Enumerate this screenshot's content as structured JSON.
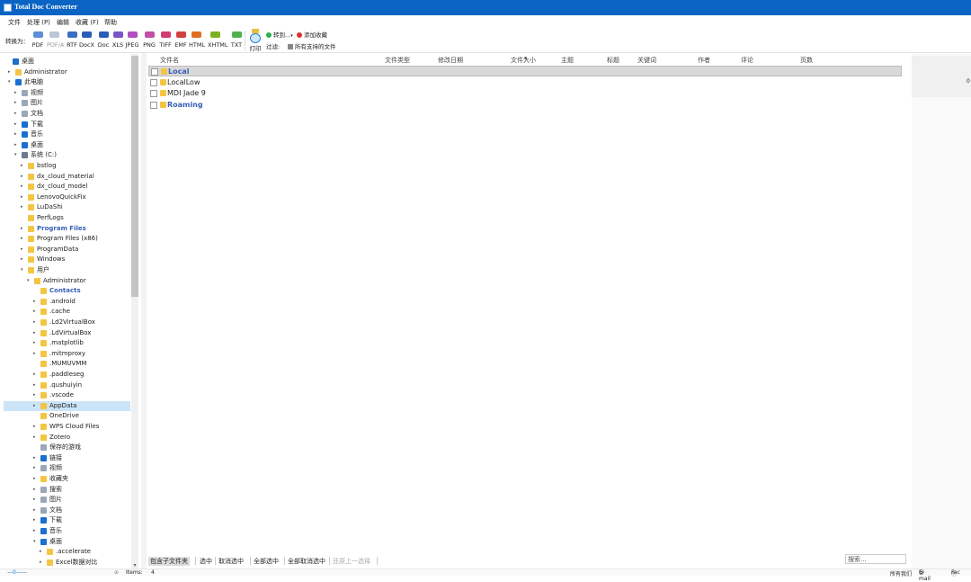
{
  "window": {
    "title": "Total Doc Converter"
  },
  "menu": [
    "文件",
    "处理 (P)",
    "编辑",
    "收藏 (F)",
    "帮助"
  ],
  "toolbar": {
    "convert_label": "转换为：",
    "formats": [
      {
        "label": "PDF",
        "color": "#5b8fd6"
      },
      {
        "label": "PDF/A",
        "color": "#b9c7d8",
        "disabled": true
      },
      {
        "label": "RTF",
        "color": "#3a6fc4"
      },
      {
        "label": "DocX",
        "color": "#2a5cb8"
      },
      {
        "label": "Doc",
        "color": "#2a5cb8"
      },
      {
        "label": "XLS",
        "color": "#7a55c8"
      },
      {
        "label": "JPEG",
        "color": "#b050c0"
      },
      {
        "label": "PNG",
        "color": "#c24fa8"
      },
      {
        "label": "TIFF",
        "color": "#d03a70"
      },
      {
        "label": "EMF",
        "color": "#d04040"
      },
      {
        "label": "HTML",
        "color": "#e07020"
      },
      {
        "label": "XHTML",
        "color": "#80b020"
      },
      {
        "label": "TXT",
        "color": "#50b050"
      }
    ],
    "print_label": "打印",
    "goto_label": "转到...",
    "add_fav_label": "添加收藏",
    "filter_label": "过滤:",
    "filter_value": "所有支持的文件"
  },
  "tree": [
    {
      "label": "桌面",
      "level": 0,
      "icon": "blue"
    },
    {
      "label": "Administrator",
      "level": 1,
      "icon": "user",
      "arrow": "▸"
    },
    {
      "label": "此电脑",
      "level": 1,
      "icon": "pc",
      "arrow": "▾"
    },
    {
      "label": "视频",
      "level": 2,
      "icon": "gray",
      "arrow": "▸"
    },
    {
      "label": "图片",
      "level": 2,
      "icon": "gray",
      "arrow": "▸"
    },
    {
      "label": "文档",
      "level": 2,
      "icon": "gray",
      "arrow": "▸"
    },
    {
      "label": "下载",
      "level": 2,
      "icon": "blue",
      "arrow": "▸"
    },
    {
      "label": "音乐",
      "level": 2,
      "icon": "blue",
      "arrow": "▸"
    },
    {
      "label": "桌面",
      "level": 2,
      "icon": "blue",
      "arrow": "▸"
    },
    {
      "label": "系统 (C:)",
      "level": 2,
      "icon": "drive",
      "arrow": "▾"
    },
    {
      "label": "bstlog",
      "level": 3,
      "icon": "folder",
      "arrow": "▸"
    },
    {
      "label": "dx_cloud_material",
      "level": 3,
      "icon": "folder",
      "arrow": "▸"
    },
    {
      "label": "dx_cloud_model",
      "level": 3,
      "icon": "folder",
      "arrow": "▸"
    },
    {
      "label": "LenovoQuickFix",
      "level": 3,
      "icon": "folder",
      "arrow": "▸"
    },
    {
      "label": "LuDaShi",
      "level": 3,
      "icon": "folder",
      "arrow": "▸"
    },
    {
      "label": "PerfLogs",
      "level": 3,
      "icon": "folder",
      "arrow": ""
    },
    {
      "label": "Program Files",
      "level": 3,
      "icon": "folder",
      "arrow": "▸",
      "bold": true
    },
    {
      "label": "Program Files (x86)",
      "level": 3,
      "icon": "folder",
      "arrow": "▸"
    },
    {
      "label": "ProgramData",
      "level": 3,
      "icon": "folder",
      "arrow": "▸"
    },
    {
      "label": "Windows",
      "level": 3,
      "icon": "folder",
      "arrow": "▸"
    },
    {
      "label": "用户",
      "level": 3,
      "icon": "folder",
      "arrow": "▾"
    },
    {
      "label": "Administrator",
      "level": 4,
      "icon": "folder",
      "arrow": "▾"
    },
    {
      "label": "Contacts",
      "level": 5,
      "icon": "folder",
      "arrow": "",
      "bold": true
    },
    {
      "label": ".android",
      "level": 5,
      "icon": "folder",
      "arrow": "▸"
    },
    {
      "label": ".cache",
      "level": 5,
      "icon": "folder",
      "arrow": "▸"
    },
    {
      "label": ".Ld2VirtualBox",
      "level": 5,
      "icon": "folder",
      "arrow": "▸"
    },
    {
      "label": ".LdVirtualBox",
      "level": 5,
      "icon": "folder",
      "arrow": "▸"
    },
    {
      "label": ".matplotlib",
      "level": 5,
      "icon": "folder",
      "arrow": "▸"
    },
    {
      "label": ".mitmproxy",
      "level": 5,
      "icon": "folder",
      "arrow": "▸"
    },
    {
      "label": ".MUMUVMM",
      "level": 5,
      "icon": "folder",
      "arrow": ""
    },
    {
      "label": ".paddleseg",
      "level": 5,
      "icon": "folder",
      "arrow": "▸"
    },
    {
      "label": ".qushuiyin",
      "level": 5,
      "icon": "folder",
      "arrow": "▸"
    },
    {
      "label": ".vscode",
      "level": 5,
      "icon": "folder",
      "arrow": "▸"
    },
    {
      "label": "AppData",
      "level": 5,
      "icon": "folder",
      "arrow": "▸",
      "selected": true
    },
    {
      "label": "OneDrive",
      "level": 5,
      "icon": "folder",
      "arrow": ""
    },
    {
      "label": "WPS Cloud Files",
      "level": 5,
      "icon": "folder",
      "arrow": "▸"
    },
    {
      "label": "Zotero",
      "level": 5,
      "icon": "folder",
      "arrow": "▸"
    },
    {
      "label": "保存的游戏",
      "level": 5,
      "icon": "gray",
      "arrow": ""
    },
    {
      "label": "链接",
      "level": 5,
      "icon": "blue",
      "arrow": "▸"
    },
    {
      "label": "视频",
      "level": 5,
      "icon": "gray",
      "arrow": "▸"
    },
    {
      "label": "收藏夹",
      "level": 5,
      "icon": "folder",
      "arrow": "▸"
    },
    {
      "label": "搜索",
      "level": 5,
      "icon": "gray",
      "arrow": "▸"
    },
    {
      "label": "图片",
      "level": 5,
      "icon": "gray",
      "arrow": "▸"
    },
    {
      "label": "文档",
      "level": 5,
      "icon": "gray",
      "arrow": "▸"
    },
    {
      "label": "下载",
      "level": 5,
      "icon": "blue",
      "arrow": "▸"
    },
    {
      "label": "音乐",
      "level": 5,
      "icon": "blue",
      "arrow": "▸"
    },
    {
      "label": "桌面",
      "level": 5,
      "icon": "blue",
      "arrow": "▾"
    },
    {
      "label": ".accelerate",
      "level": 6,
      "icon": "folder",
      "arrow": "▸"
    },
    {
      "label": "Excel数据对比",
      "level": 6,
      "icon": "folder",
      "arrow": "▸"
    }
  ],
  "columns": [
    "文件名",
    "文件类型",
    "修改日期",
    "文件大小",
    "主题",
    "标题",
    "关键词",
    "作者",
    "评论",
    "页数"
  ],
  "files": [
    {
      "name": "Local",
      "bold": true,
      "selected": true
    },
    {
      "name": "LocalLow",
      "bold": false,
      "selected": false
    },
    {
      "name": "MDI Jade 9",
      "bold": false,
      "selected": false
    },
    {
      "name": "Roaming",
      "bold": true,
      "selected": false
    }
  ],
  "bottom_buttons": [
    {
      "label": "包含子文件夹",
      "state": "active"
    },
    {
      "label": "选中",
      "state": "normal"
    },
    {
      "label": "取消选中",
      "state": "normal"
    },
    {
      "label": "全部选中",
      "state": "normal"
    },
    {
      "label": "全部取消选中",
      "state": "normal"
    },
    {
      "label": "还原上一选择",
      "state": "disabled"
    }
  ],
  "search_placeholder": "搜索...",
  "preview_text": "0",
  "status": {
    "items_label": "Items:",
    "items_count": "4",
    "right_text": "所有我们",
    "email": "E-mail",
    "email2": "Fac"
  }
}
